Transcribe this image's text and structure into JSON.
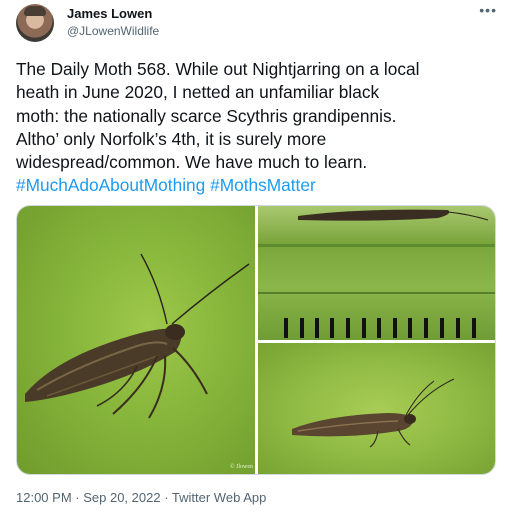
{
  "author": {
    "name": "James Lowen",
    "handle": "@JLowenWildlife"
  },
  "menu_icon": "more-horizontal-icon",
  "tweet": {
    "lines": [
      "The Daily Moth 568. While out Nightjarring on a local",
      "heath in June 2020, I netted an unfamiliar black",
      "moth: the nationally scarce Scythris grandipennis.",
      "Altho’ only Norfolk’s 4th, it is surely more",
      "widespread/common. We have much to learn."
    ],
    "hashtags": [
      "#MuchAdoAboutMothing",
      "#MothsMatter"
    ]
  },
  "photos": {
    "watermark": "© Jlowen"
  },
  "footer": {
    "time": "12:00 PM",
    "separator": " · ",
    "date": "Sep 20, 2022",
    "source": "Twitter Web App"
  }
}
